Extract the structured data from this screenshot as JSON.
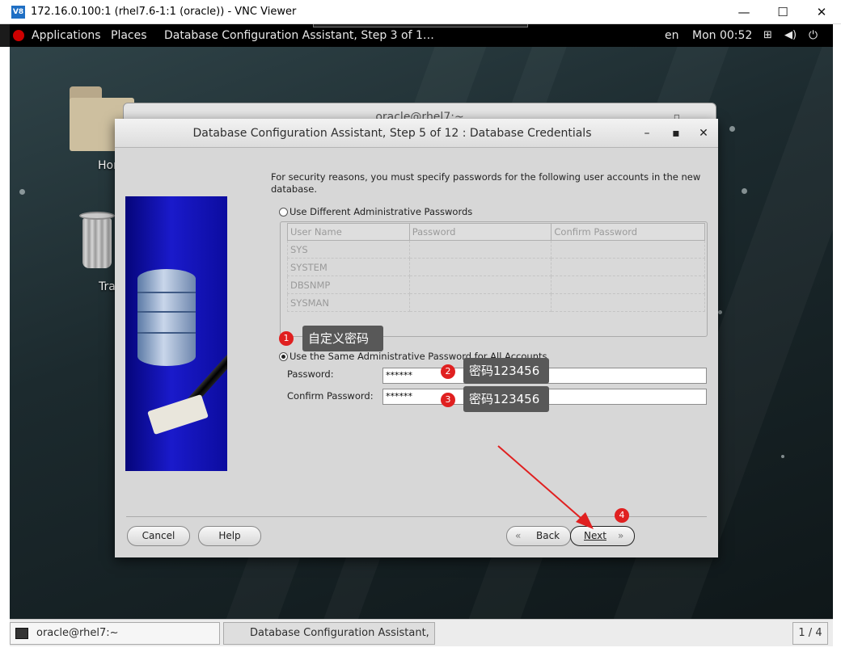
{
  "vnc": {
    "title": "172.16.0.100:1 (rhel7.6-1:1 (oracle)) - VNC Viewer",
    "logo": "V8",
    "minimize": "—",
    "maximize": "☐",
    "close": "✕"
  },
  "topbar": {
    "applications": "Applications",
    "places": "Places",
    "active_window": "Database Configuration Assistant, Step 3 of 1…",
    "language": "en",
    "clock": "Mon 00:52"
  },
  "desktop": {
    "home_label": "Hom",
    "trash_label": "Tra"
  },
  "terminal": {
    "title": "oracle@rhel7:~"
  },
  "dbca": {
    "title": "Database Configuration Assistant, Step 5 of 12 : Database Credentials",
    "intro": "For security reasons, you must specify passwords for the following user accounts in the new database.",
    "opt_different": "Use Different Administrative Passwords",
    "opt_same": "Use the Same Administrative Password for All Accounts",
    "columns": [
      "User Name",
      "Password",
      "Confirm Password"
    ],
    "users": [
      "SYS",
      "SYSTEM",
      "DBSNMP",
      "SYSMAN"
    ],
    "password_label": "Password:",
    "confirm_label": "Confirm Password:",
    "password_value": "******",
    "confirm_value": "******",
    "cancel": "Cancel",
    "help": "Help",
    "back": "Back",
    "next": "Next"
  },
  "annotations": [
    {
      "num": "1",
      "text": "自定义密码"
    },
    {
      "num": "2",
      "text": "密码123456"
    },
    {
      "num": "3",
      "text": "密码123456"
    },
    {
      "num": "4",
      "text": ""
    }
  ],
  "taskbar": {
    "terminal_task": "oracle@rhel7:~",
    "dbca_task": "Database Configuration Assistant, St…",
    "workspace": "1 / 4"
  },
  "colors": {
    "annotation_red": "#e02020",
    "annotation_box": "#585858",
    "dialog_bg": "#d7d7d7"
  }
}
